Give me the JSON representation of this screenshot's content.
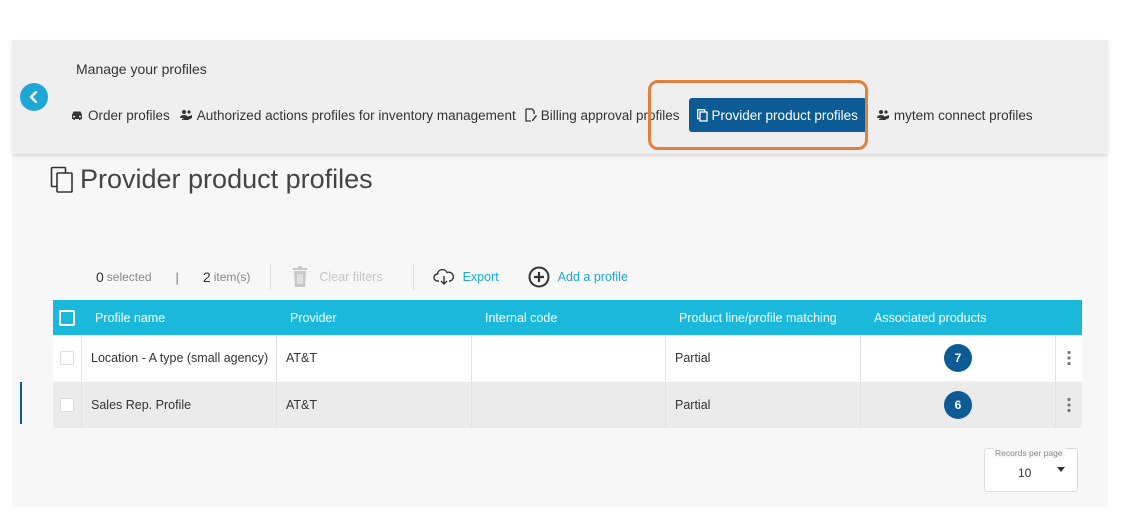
{
  "header": {
    "title": "Manage your profiles",
    "tabs": [
      {
        "label": "Order profiles",
        "icon": "car-icon"
      },
      {
        "label": "Authorized actions profiles for inventory management",
        "icon": "users-hand-icon"
      },
      {
        "label": "Billing approval profiles",
        "icon": "document-edit-icon"
      },
      {
        "label": "Provider product profiles",
        "icon": "copy-icon",
        "active": true
      },
      {
        "label": "mytem connect profiles",
        "icon": "users-hand-icon"
      }
    ]
  },
  "page": {
    "title": "Provider product profiles",
    "icon": "copy-icon"
  },
  "toolbar": {
    "selected_count": "0",
    "selected_label": "selected",
    "items_count": "2",
    "items_label": "item(s)",
    "separator": "|",
    "clear_filters": "Clear filters",
    "export": "Export",
    "add_profile": "Add a profile"
  },
  "table": {
    "columns": [
      "Profile name",
      "Provider",
      "Internal code",
      "Product line/profile matching",
      "Associated products"
    ],
    "rows": [
      {
        "name": "Location - A type (small agency)",
        "provider": "AT&T",
        "internal_code": "",
        "matching": "Partial",
        "associated": "7"
      },
      {
        "name": "Sales Rep. Profile",
        "provider": "AT&T",
        "internal_code": "",
        "matching": "Partial",
        "associated": "6"
      }
    ]
  },
  "pagination": {
    "label": "Records per page",
    "value": "10"
  },
  "colors": {
    "accent": "#1ab8da",
    "primary": "#0d5b94",
    "highlight": "#e2803a"
  }
}
